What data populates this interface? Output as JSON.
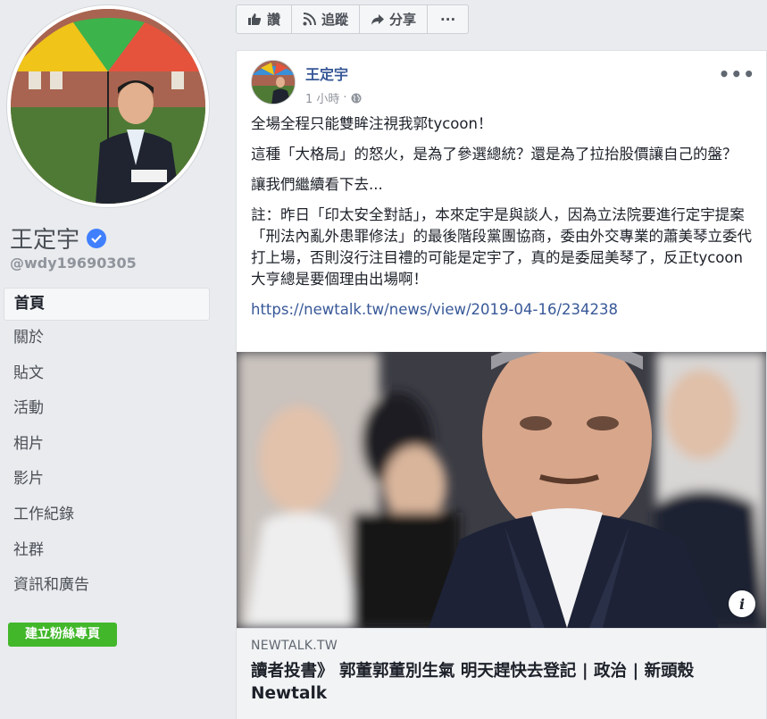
{
  "page": {
    "name": "王定宇",
    "handle": "@wdy19690305"
  },
  "nav": {
    "items": [
      {
        "label": "首頁",
        "active": true
      },
      {
        "label": "關於"
      },
      {
        "label": "貼文"
      },
      {
        "label": "活動"
      },
      {
        "label": "相片"
      },
      {
        "label": "影片"
      },
      {
        "label": "工作紀錄"
      },
      {
        "label": "社群"
      },
      {
        "label": "資訊和廣告"
      }
    ],
    "create_label": "建立粉絲專頁"
  },
  "actions": {
    "like": "讚",
    "follow": "追蹤",
    "share": "分享",
    "more": "···"
  },
  "post": {
    "author": "王定宇",
    "time": "1 小時",
    "more": "•••",
    "paragraphs": [
      "全場全程只能雙眸注視我郭tycoon！",
      "這種「大格局」的怒火，是為了參選總統？還是為了拉抬股價讓自己的盤？",
      "讓我們繼續看下去...",
      "註：昨日「印太安全對話」，本來定宇是與談人，因為立法院要進行定宇提案「刑法內亂外患罪修法」的最後階段黨團協商，委由外交專業的蕭美琴立委代打上場，否則沒行注目禮的可能是定宇了，真的是委屈美琴了，反正tycoon大亨總是要個理由出場啊！"
    ],
    "link": "https://newtalk.tw/news/view/2019-04-16/234238",
    "preview": {
      "domain": "NEWTALK.TW",
      "headline": "讀者投書》 郭董郭董別生氣 明天趕快去登記 | 政治 | 新頭殼 Newtalk",
      "info": "i"
    }
  },
  "colors": {
    "link": "#385898",
    "create_button": "#42b72a",
    "verified": "#4080ff"
  }
}
